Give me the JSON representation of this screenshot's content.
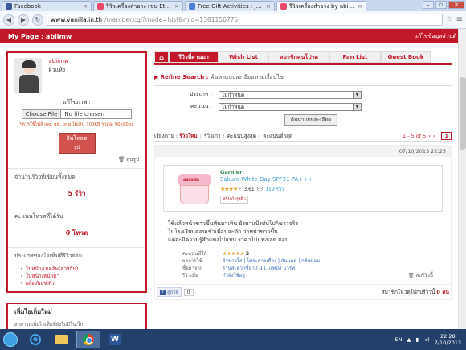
{
  "browser": {
    "tabs": [
      {
        "title": "Facebook",
        "active": false
      },
      {
        "title": "รีวิวเครื่องสำอาง เช่น Etude",
        "active": false
      },
      {
        "title": "Free Gift Activities : Join",
        "active": false
      },
      {
        "title": "รีวิวเครื่องสำอาง by abiimw",
        "active": true
      }
    ],
    "url_host": "www.vanilla.in.th",
    "url_path": "/member.cgi?mode=hist&mid=1381156775"
  },
  "header": {
    "mypage_label": "My Page : abiimw",
    "edit_link": "แก้ไขข้อมูลส่วนตัว"
  },
  "profile": {
    "username": "abiimw",
    "skin_type": "ผิวแห้ง",
    "upload_label": "แก้ไขภาพ :",
    "choose_file": "Choose File",
    "no_file": "No file chosen",
    "note": "*ควรใช้ไฟล์ jpg, gif, png ไม่เกิน 300KB ขนาด 90x90px",
    "upload_button": "อัพโหลดรูป",
    "delete_link": "ลบรูป"
  },
  "stats": {
    "reviews_label": "จำนวนรีวิวที่เขียนทั้งหมด",
    "reviews_value": "5 รีวิว",
    "votes_label": "คะแนนโหวตที่ได้รับ",
    "votes_value": "0 โหวต",
    "categories_label": "ประเภทของไอเท็มที่รีวิวย่อย",
    "categories": [
      "ใบหน้า/เมคอัพ(สารกัน)",
      "ใบหน้า/หน้าตา",
      "ผลิตภัณฑ์ทั่ว"
    ]
  },
  "sidebar2": {
    "heading": "เพิ่มไอเท็มใหม่",
    "sub": "สามารถเพิ่มไอเท็มที่ยังไม่มีในเว็บ"
  },
  "tabs": {
    "home": "⌂",
    "items": [
      "รีวิวที่ผ่านมา",
      "Wish List",
      "สมาชิกคนโปรด",
      "Fan List",
      "Guest Book"
    ]
  },
  "refine": {
    "title": "Refine Search :",
    "subtitle": "ค้นหาแบบละเอียดตามเงื่อนไข",
    "type_label": "ประเภท :",
    "type_value": "ไม่กำหนด",
    "score_label": "คะแนน :",
    "score_value": "ไม่กำหนด",
    "search_button": "ค้นหาแบบละเอียด"
  },
  "sort": {
    "label": "เรียงตาม :",
    "options": [
      "รีวิวใหม่",
      "รีวิวเก่า",
      "คะแนนสูงสุด",
      "คะแนนต่ำสุด"
    ],
    "range": "1 - 5 of 5",
    "current_page": "1"
  },
  "review": {
    "date": "07/10/2013 22:25",
    "brand": "Garnier",
    "product": "Sakura White Day SPF21 PA+++",
    "rating_avg": "3.61",
    "review_count": "119 รีวิว",
    "tag": "ครีมบำรุงผิว",
    "text_lines": [
      "ใช้แล้วหน้าขาวขึ้นทันตาเห็น ยังหาแป้งทับไปก็ขาวจริง",
      "ไปโรงเรียนตอนเช้าเพื่อนจะทัก ว่าหน้าขาวขึ้น",
      "แต่จะมีความรู้สึกแพงไปแบบ ราคาไม่แพงเลย ตอบ"
    ],
    "meta": [
      {
        "key": "คะแนนที่ให้",
        "value": "5",
        "stars": true
      },
      {
        "key": "ผลการใช้",
        "value": "ผิวขาวใส | ไม่ระคายเคือง | กันแดด | กลิ่นหอม"
      },
      {
        "key": "ซื้อมาจาก",
        "value": "ร้านสะดวกซื้อ (7-11, แฟมิลี่ มาร์ท)"
      },
      {
        "key": "รีวิวเมื่อ",
        "value": "กำลังใช้อยู่"
      }
    ],
    "delete": "ลบรีวิวนี้"
  },
  "footer": {
    "like": "ถูกใจ",
    "like_count": "0",
    "helpful_label": "สมาชิกโหวตให้กับรีวิวนี้",
    "helpful_value": "0 คน"
  },
  "taskbar": {
    "lang": "EN",
    "time": "22:28",
    "date": "7/10/2013"
  }
}
